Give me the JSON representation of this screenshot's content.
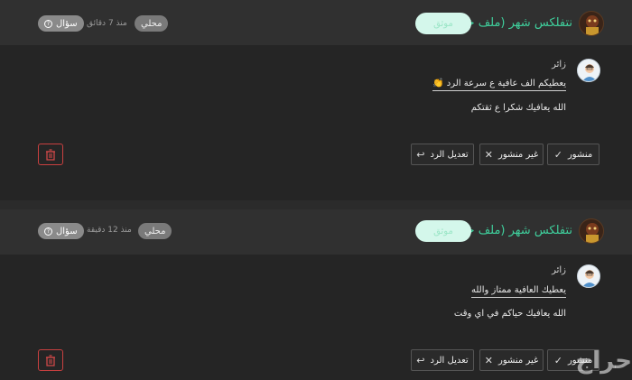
{
  "posts": [
    {
      "author": "نتفلكس شهر (ملف خاص )",
      "status_pill": "موثق",
      "badge": "محلي",
      "time": "منذ 7 دقائق",
      "question_label": "سؤال",
      "visitor_label": "زائر",
      "message": "يعطيكم الف عافية ع سرعة الرد 👏",
      "reply": "الله يعافيك شكرا ع ثقتكم",
      "buttons": {
        "published": "منشور",
        "unpublished": "غير منشور",
        "edit_reply": "تعديل الرد"
      }
    },
    {
      "author": "نتفلكس شهر (ملف خاص )",
      "status_pill": "موثق",
      "badge": "محلي",
      "time": "منذ 12 دقيقة",
      "question_label": "سؤال",
      "visitor_label": "زائر",
      "message": "يعطيك العافية ممتاز والله",
      "reply": "الله يعافيك حياكم في اي وقت",
      "buttons": {
        "published": "منشور",
        "unpublished": "غير منشور",
        "edit_reply": "تعديل الرد"
      }
    }
  ],
  "watermark": "حراج",
  "colors": {
    "accent_green": "#3fcf9c",
    "delete_red": "#c94040"
  }
}
